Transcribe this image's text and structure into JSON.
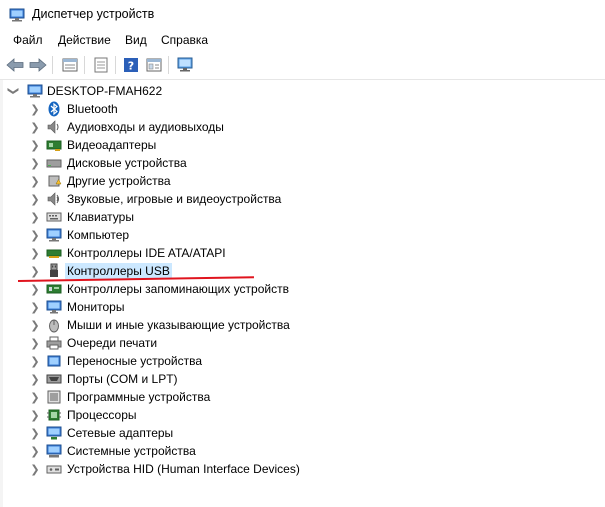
{
  "window": {
    "title": "Диспетчер устройств",
    "icon": "device-manager-icon"
  },
  "menu": [
    {
      "label": "Файл",
      "name": "menu-file"
    },
    {
      "label": "Действие",
      "name": "menu-action"
    },
    {
      "label": "Вид",
      "name": "menu-view"
    },
    {
      "label": "Справка",
      "name": "menu-help"
    }
  ],
  "toolbar": [
    {
      "icon": "back-arrow-icon",
      "name": "back-button"
    },
    {
      "icon": "forward-arrow-icon",
      "name": "forward-button"
    },
    {
      "icon": "device-view-icon",
      "name": "view-devices-button"
    },
    {
      "icon": "properties-icon",
      "name": "properties-button"
    },
    {
      "icon": "help-icon",
      "name": "help-button"
    },
    {
      "icon": "resources-view-icon",
      "name": "view-resources-button"
    },
    {
      "icon": "monitor-scan-icon",
      "name": "scan-hardware-button"
    }
  ],
  "tree": {
    "root": {
      "label": "DESKTOP-FMAH622",
      "icon": "computer-icon",
      "expanded": true
    },
    "items": [
      {
        "label": "Bluetooth",
        "icon": "bluetooth-icon"
      },
      {
        "label": "Аудиовходы и аудиовыходы",
        "icon": "speaker-icon"
      },
      {
        "label": "Видеоадаптеры",
        "icon": "display-adapter-icon"
      },
      {
        "label": "Дисковые устройства",
        "icon": "disk-drive-icon"
      },
      {
        "label": "Другие устройства",
        "icon": "unknown-device-icon"
      },
      {
        "label": "Звуковые, игровые и видеоустройства",
        "icon": "sound-icon"
      },
      {
        "label": "Клавиатуры",
        "icon": "keyboard-icon"
      },
      {
        "label": "Компьютер",
        "icon": "computer-icon"
      },
      {
        "label": "Контроллеры IDE ATA/ATAPI",
        "icon": "ide-controller-icon"
      },
      {
        "label": "Контроллеры USB",
        "icon": "usb-icon",
        "selected": true
      },
      {
        "label": "Контроллеры запоминающих устройств",
        "icon": "storage-controller-icon"
      },
      {
        "label": "Мониторы",
        "icon": "monitor-icon"
      },
      {
        "label": "Мыши и иные указывающие устройства",
        "icon": "mouse-icon"
      },
      {
        "label": "Очереди печати",
        "icon": "printer-icon"
      },
      {
        "label": "Переносные устройства",
        "icon": "portable-device-icon"
      },
      {
        "label": "Порты (COM и LPT)",
        "icon": "port-icon"
      },
      {
        "label": "Программные устройства",
        "icon": "software-device-icon"
      },
      {
        "label": "Процессоры",
        "icon": "processor-icon"
      },
      {
        "label": "Сетевые адаптеры",
        "icon": "network-adapter-icon"
      },
      {
        "label": "Системные устройства",
        "icon": "system-device-icon"
      },
      {
        "label": "Устройства HID (Human Interface Devices)",
        "icon": "hid-icon"
      }
    ]
  },
  "annotation": {
    "color": "#e0141e",
    "target": "Контроллеры USB"
  }
}
